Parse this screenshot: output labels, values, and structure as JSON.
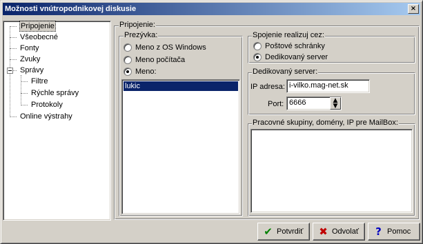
{
  "window": {
    "title": "Možnosti vnútropodnikovej diskusie",
    "close_glyph": "×"
  },
  "tree": {
    "items": [
      {
        "label": "Pripojenie",
        "selected": true
      },
      {
        "label": "Všeobecné"
      },
      {
        "label": "Fonty"
      },
      {
        "label": "Zvuky"
      },
      {
        "label": "Správy",
        "expanded": true
      },
      {
        "label": "Filtre"
      },
      {
        "label": "Rýchle správy"
      },
      {
        "label": "Protokoly"
      },
      {
        "label": "Online výstrahy"
      }
    ]
  },
  "panel": {
    "title": "Pripojenie:"
  },
  "nickname": {
    "label": "Prezývka:",
    "options": [
      {
        "label": "Meno z OS Windows",
        "checked": false
      },
      {
        "label": "Meno počítača",
        "checked": false
      },
      {
        "label": "Meno:",
        "checked": true
      }
    ],
    "list_items": [
      "lukic"
    ]
  },
  "connection": {
    "label": "Spojenie realizuj cez:",
    "options": [
      {
        "label": "Poštové schránky",
        "checked": false
      },
      {
        "label": "Dedikovaný server",
        "checked": true
      }
    ]
  },
  "dedicated": {
    "label": "Dedikovaný server:",
    "ip_label": "IP adresa:",
    "ip_value": "i-vilko.mag-net.sk",
    "port_label": "Port:",
    "port_value": "6666"
  },
  "mailbox": {
    "label": "Pracovné skupiny, domény, IP pre MailBox:"
  },
  "buttons": {
    "ok": {
      "label": "Potvrdiť",
      "icon": "check-icon",
      "color": "#008000"
    },
    "cancel": {
      "label": "Odvolať",
      "icon": "cross-icon",
      "color": "#c00000"
    },
    "help": {
      "label": "Pomoc",
      "icon": "question-icon",
      "color": "#0000c0"
    }
  }
}
